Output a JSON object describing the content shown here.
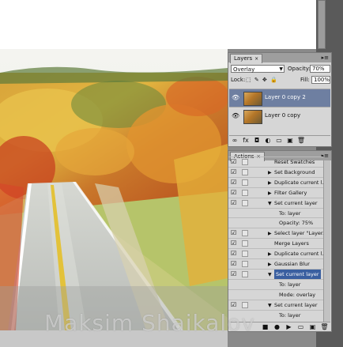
{
  "layers_panel": {
    "tab_label": "Layers",
    "tab_close": "×",
    "menu_glyph": "▸≡",
    "blend_mode": "Overlay",
    "opacity_label": "Opacity:",
    "opacity_value": "70%",
    "lock_label": "Lock:",
    "lock_icons": "⬚ ✎ ✥ 🔒",
    "fill_label": "Fill:",
    "fill_value": "100%",
    "layers": [
      {
        "name": "Layer 0 copy 2",
        "selected": true
      },
      {
        "name": "Layer 0 copy",
        "selected": false
      }
    ],
    "footer_icons": [
      "link-icon",
      "fx-icon",
      "mask-icon",
      "adjustment-icon",
      "group-icon",
      "new-layer-icon",
      "trash-icon"
    ],
    "footer_glyphs": [
      "∞",
      "fx",
      "◘",
      "◐",
      "▭",
      "▣",
      "🗑"
    ]
  },
  "actions_panel": {
    "tab_label": "Actions",
    "tab_close": "×",
    "menu_glyph": "▸≡",
    "items": [
      {
        "text": "Reset Swatches",
        "type": "item",
        "checked": true,
        "triangle": ""
      },
      {
        "text": "Set Background",
        "type": "item",
        "checked": true,
        "triangle": "▶"
      },
      {
        "text": "Duplicate current l...",
        "type": "item",
        "checked": true,
        "triangle": "▶"
      },
      {
        "text": "Filter Gallery",
        "type": "item",
        "checked": true,
        "triangle": "▶"
      },
      {
        "text": "Set current layer",
        "type": "item",
        "checked": true,
        "triangle": "▼"
      },
      {
        "text": "To: layer",
        "type": "sub",
        "checked": false,
        "triangle": ""
      },
      {
        "text": "Opacity: 75%",
        "type": "sub",
        "checked": false,
        "triangle": ""
      },
      {
        "text": "Select layer \"Layer...",
        "type": "item",
        "checked": true,
        "triangle": "▶"
      },
      {
        "text": "Merge Layers",
        "type": "item",
        "checked": true,
        "triangle": ""
      },
      {
        "text": "Duplicate current l...",
        "type": "item",
        "checked": true,
        "triangle": "▶"
      },
      {
        "text": "Gaussian Blur",
        "type": "item",
        "checked": true,
        "triangle": "▶"
      },
      {
        "text": "Set current layer",
        "type": "item",
        "checked": true,
        "triangle": "▼",
        "highlight": true
      },
      {
        "text": "To: layer",
        "type": "sub",
        "checked": false,
        "triangle": ""
      },
      {
        "text": "Mode: overlay",
        "type": "sub",
        "checked": false,
        "triangle": ""
      },
      {
        "text": "Set current layer",
        "type": "item",
        "checked": true,
        "triangle": "▼"
      },
      {
        "text": "To: layer",
        "type": "sub",
        "checked": false,
        "triangle": ""
      }
    ],
    "footer_glyphs": [
      "■",
      "●",
      "▶",
      "▭",
      "▣",
      "🗑"
    ]
  },
  "watermark": "Maksim Shaikalov",
  "colors": {
    "panel_bg": "#d6d6d6",
    "selected_layer": "#6e7fa1",
    "highlight_action": "#3a5fa0",
    "workspace_dark": "#5a5a5a"
  }
}
